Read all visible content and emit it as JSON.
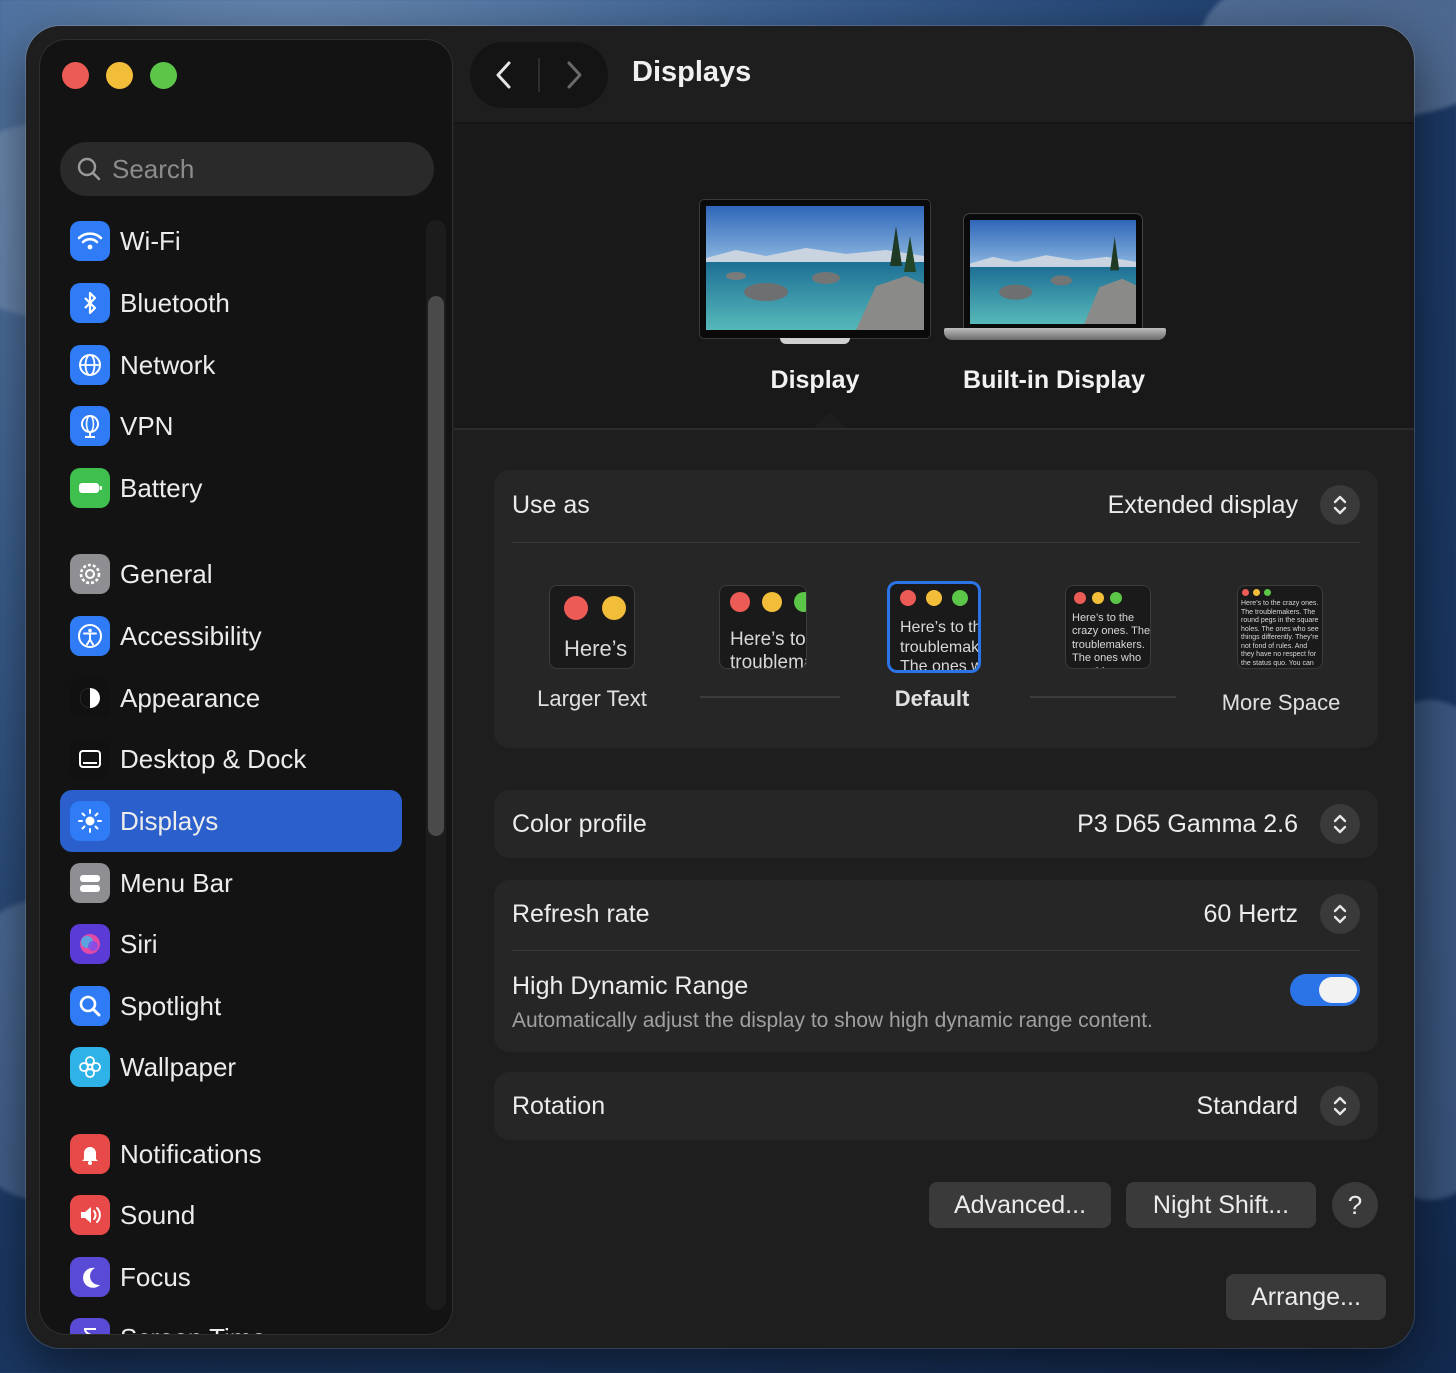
{
  "window_title": "Displays",
  "search": {
    "placeholder": "Search"
  },
  "sidebar": {
    "items": [
      {
        "label": "Wi-Fi",
        "icon": "wifi-icon",
        "color": "#2f7cf6"
      },
      {
        "label": "Bluetooth",
        "icon": "bluetooth-icon",
        "color": "#2f7cf6"
      },
      {
        "label": "Network",
        "icon": "globe-icon",
        "color": "#2f7cf6"
      },
      {
        "label": "VPN",
        "icon": "vpn-globe-icon",
        "color": "#2f7cf6"
      },
      {
        "label": "Battery",
        "icon": "battery-icon",
        "color": "#3fbf4d"
      },
      {
        "label": "General",
        "icon": "gear-icon",
        "color": "#8e8e93"
      },
      {
        "label": "Accessibility",
        "icon": "accessibility-icon",
        "color": "#2f7cf6"
      },
      {
        "label": "Appearance",
        "icon": "appearance-icon",
        "color": "#111111"
      },
      {
        "label": "Desktop & Dock",
        "icon": "dock-icon",
        "color": "#111111"
      },
      {
        "label": "Displays",
        "icon": "sun-icon",
        "color": "#2f7cf6",
        "active": true
      },
      {
        "label": "Menu Bar",
        "icon": "menubar-icon",
        "color": "#8e8e93"
      },
      {
        "label": "Siri",
        "icon": "siri-icon",
        "color": "#5a3bd6"
      },
      {
        "label": "Spotlight",
        "icon": "magnifier-icon",
        "color": "#2f7cf6"
      },
      {
        "label": "Wallpaper",
        "icon": "flower-icon",
        "color": "#2fb2e8"
      },
      {
        "label": "Notifications",
        "icon": "bell-icon",
        "color": "#e84a4a"
      },
      {
        "label": "Sound",
        "icon": "speaker-icon",
        "color": "#e84a4a"
      },
      {
        "label": "Focus",
        "icon": "moon-icon",
        "color": "#5a4bd6"
      },
      {
        "label": "Screen Time",
        "icon": "hourglass-icon",
        "color": "#5a4bd6"
      }
    ]
  },
  "displays": [
    {
      "label": "Display",
      "selected": true
    },
    {
      "label": "Built-in Display",
      "selected": false
    }
  ],
  "use_as": {
    "label": "Use as",
    "value": "Extended display"
  },
  "resolution": {
    "options": [
      {
        "label": "Larger Text",
        "preview": "Here’s"
      },
      {
        "label": "",
        "preview": "Here’s to the troublemakers"
      },
      {
        "label": "Default",
        "preview": "Here’s to the troublemakers. The ones who",
        "selected": true
      },
      {
        "label": "",
        "preview": "Here’s to the crazy ones. The troublemakers. The ones who see things differently. rules. And they"
      },
      {
        "label": "More Space",
        "preview": "Here’s to the crazy ones. The troublemakers. The round pegs in the square holes. The ones who see things differently. They’re not fond of rules. And they have no respect for the status quo. You can quote them, disagree with them. About the only thing you can’t do is ignore them. Because they change things."
      }
    ]
  },
  "color_profile": {
    "label": "Color profile",
    "value": "P3 D65 Gamma 2.6"
  },
  "refresh_rate": {
    "label": "Refresh rate",
    "value": "60 Hertz"
  },
  "hdr": {
    "label": "High Dynamic Range",
    "description": "Automatically adjust the display to show high dynamic range content.",
    "enabled": true
  },
  "rotation": {
    "label": "Rotation",
    "value": "Standard"
  },
  "buttons": {
    "advanced": "Advanced...",
    "night_shift": "Night Shift...",
    "help": "?",
    "arrange": "Arrange..."
  },
  "colors": {
    "accent": "#2a5fcc",
    "toggle_on": "#2b74e8"
  }
}
